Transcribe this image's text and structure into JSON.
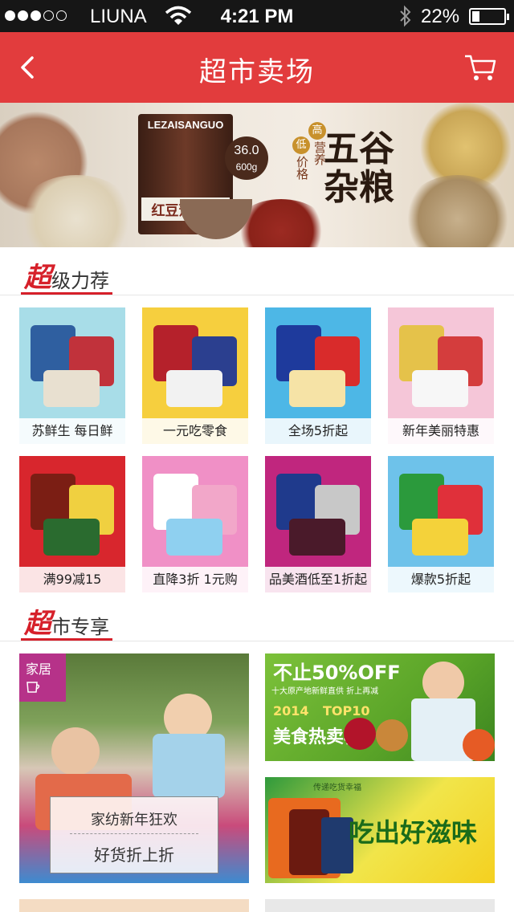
{
  "status_bar": {
    "carrier": "LIUNA",
    "time": "4:21 PM",
    "battery_pct": "22%",
    "signal_bars_filled": 3,
    "signal_bars_total": 5
  },
  "navbar": {
    "title": "超市卖场",
    "back_icon": "chevron-left-icon",
    "cart_icon": "cart-icon"
  },
  "banner": {
    "brand": "LEZAISANGUO",
    "product_label": "红豆薏仁粉",
    "weight_top": "36.0",
    "weight_bottom": "600g",
    "headline": "五谷杂粮",
    "seal_high": "高",
    "seal_low": "低",
    "tag_nutrition": "营养",
    "tag_price": "价格"
  },
  "sections": {
    "super_recommend": {
      "first": "超",
      "rest": "级力荐"
    },
    "super_exclusive": {
      "first": "超",
      "rest": "市专享"
    }
  },
  "tiles": [
    {
      "label": "苏鲜生  每日鲜",
      "bg": "#a8dde8"
    },
    {
      "label": "一元吃零食",
      "bg": "#f6cf3e"
    },
    {
      "label": "全场5折起",
      "bg": "#4db7e6"
    },
    {
      "label": "新年美丽特惠",
      "bg": "#f5c6d8"
    },
    {
      "label": "满99减15",
      "bg": "#d8262d"
    },
    {
      "label": "直降3折 1元购",
      "bg": "#f090c6"
    },
    {
      "label": "品美酒低至1折起",
      "bg": "#c0267e"
    },
    {
      "label": "爆款5折起",
      "bg": "#6ec2ea"
    }
  ],
  "exclusive": {
    "home_tag": "家居",
    "home_line1": "家纺新年狂欢",
    "home_line2": "好货折上折",
    "food_top_title": "不止50%OFF",
    "food_top_sub": "十大原产地新鲜直供 折上再减",
    "food_top_year": "2014",
    "food_top_rank": "TOP10",
    "food_top_name": "美食热卖榜",
    "food_bottom_title": "吃出好滋味",
    "food_bottom_tag": "传递吃货幸福"
  }
}
